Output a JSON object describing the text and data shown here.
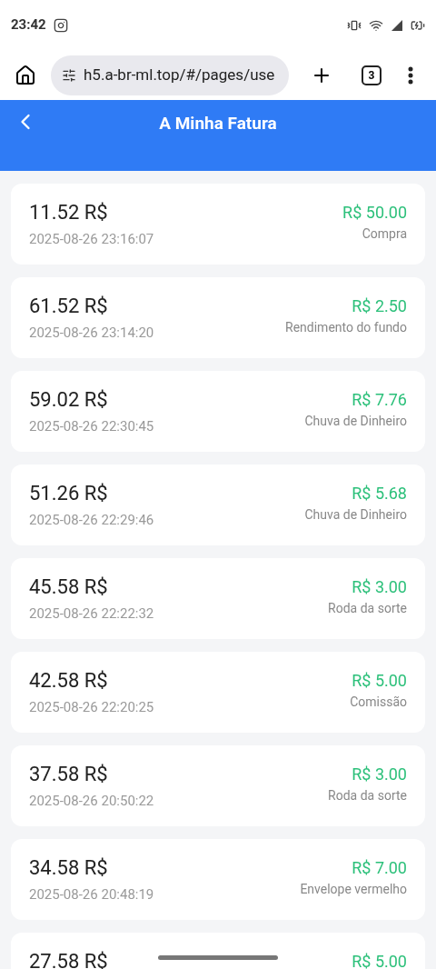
{
  "status_bar": {
    "time": "23:42"
  },
  "browser": {
    "url": "h5.a-br-ml.top/#/pages/use",
    "tab_count": "3"
  },
  "header": {
    "title": "A Minha Fatura"
  },
  "transactions": [
    {
      "balance": "11.52 R$",
      "date": "2025-08-26 23:16:07",
      "amount": "R$ 50.00",
      "type": "Compra"
    },
    {
      "balance": "61.52 R$",
      "date": "2025-08-26 23:14:20",
      "amount": "R$ 2.50",
      "type": "Rendimento do fundo"
    },
    {
      "balance": "59.02 R$",
      "date": "2025-08-26 22:30:45",
      "amount": "R$ 7.76",
      "type": "Chuva de Dinheiro"
    },
    {
      "balance": "51.26 R$",
      "date": "2025-08-26 22:29:46",
      "amount": "R$ 5.68",
      "type": "Chuva de Dinheiro"
    },
    {
      "balance": "45.58 R$",
      "date": "2025-08-26 22:22:32",
      "amount": "R$ 3.00",
      "type": "Roda da sorte"
    },
    {
      "balance": "42.58 R$",
      "date": "2025-08-26 22:20:25",
      "amount": "R$ 5.00",
      "type": "Comissão"
    },
    {
      "balance": "37.58 R$",
      "date": "2025-08-26 20:50:22",
      "amount": "R$ 3.00",
      "type": "Roda da sorte"
    },
    {
      "balance": "34.58 R$",
      "date": "2025-08-26 20:48:19",
      "amount": "R$ 7.00",
      "type": "Envelope vermelho"
    },
    {
      "balance": "27.58 R$",
      "amount": "R$ 5.00"
    }
  ]
}
